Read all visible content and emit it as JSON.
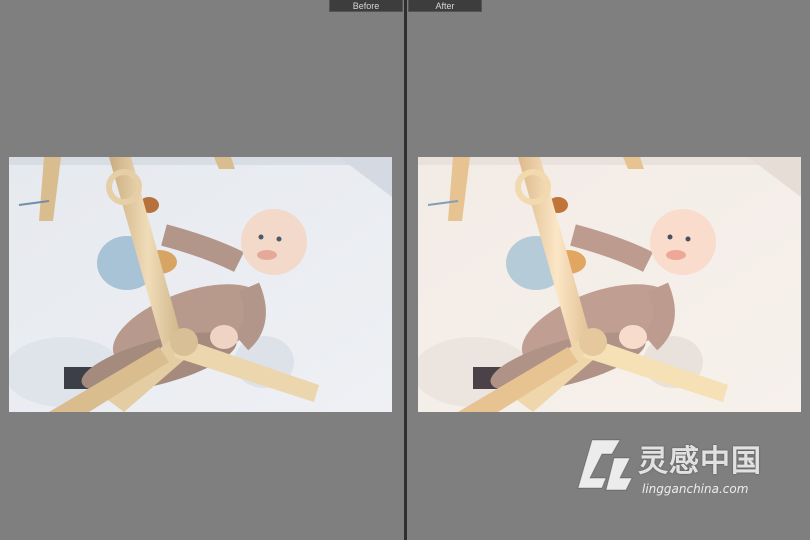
{
  "view": {
    "before_label": "Before",
    "after_label": "After"
  },
  "watermark": {
    "brand_text": "灵感中国",
    "url_text": "lingganchina.com",
    "logo_icon": "lingganchina-logo-icon"
  },
  "colors": {
    "background": "#7f7f7f",
    "divider": "#2e2e2e",
    "tab_bg": "#3d3d3d",
    "tab_text": "#d6d6d6"
  }
}
